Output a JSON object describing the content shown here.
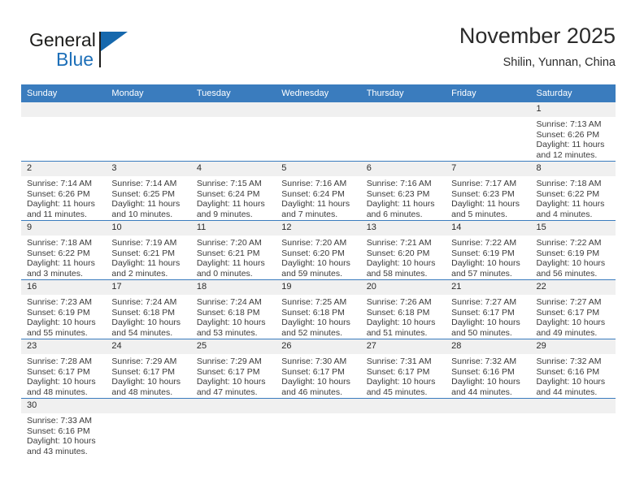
{
  "brand": {
    "name_part1": "General",
    "name_part2": "Blue"
  },
  "header": {
    "title": "November 2025",
    "subtitle": "Shilin, Yunnan, China"
  },
  "colors": {
    "header_blue": "#3a7cbe",
    "brand_blue": "#1d6fb8",
    "date_band": "#f0f0f0"
  },
  "weekday_headers": [
    "Sunday",
    "Monday",
    "Tuesday",
    "Wednesday",
    "Thursday",
    "Friday",
    "Saturday"
  ],
  "weeks": [
    [
      {
        "day": "",
        "sunrise": "",
        "sunset": "",
        "daylight1": "",
        "daylight2": "",
        "blank": true
      },
      {
        "day": "",
        "sunrise": "",
        "sunset": "",
        "daylight1": "",
        "daylight2": "",
        "blank": true
      },
      {
        "day": "",
        "sunrise": "",
        "sunset": "",
        "daylight1": "",
        "daylight2": "",
        "blank": true
      },
      {
        "day": "",
        "sunrise": "",
        "sunset": "",
        "daylight1": "",
        "daylight2": "",
        "blank": true
      },
      {
        "day": "",
        "sunrise": "",
        "sunset": "",
        "daylight1": "",
        "daylight2": "",
        "blank": true
      },
      {
        "day": "",
        "sunrise": "",
        "sunset": "",
        "daylight1": "",
        "daylight2": "",
        "blank": true
      },
      {
        "day": "1",
        "sunrise": "Sunrise: 7:13 AM",
        "sunset": "Sunset: 6:26 PM",
        "daylight1": "Daylight: 11 hours",
        "daylight2": "and 12 minutes."
      }
    ],
    [
      {
        "day": "2",
        "sunrise": "Sunrise: 7:14 AM",
        "sunset": "Sunset: 6:26 PM",
        "daylight1": "Daylight: 11 hours",
        "daylight2": "and 11 minutes."
      },
      {
        "day": "3",
        "sunrise": "Sunrise: 7:14 AM",
        "sunset": "Sunset: 6:25 PM",
        "daylight1": "Daylight: 11 hours",
        "daylight2": "and 10 minutes."
      },
      {
        "day": "4",
        "sunrise": "Sunrise: 7:15 AM",
        "sunset": "Sunset: 6:24 PM",
        "daylight1": "Daylight: 11 hours",
        "daylight2": "and 9 minutes."
      },
      {
        "day": "5",
        "sunrise": "Sunrise: 7:16 AM",
        "sunset": "Sunset: 6:24 PM",
        "daylight1": "Daylight: 11 hours",
        "daylight2": "and 7 minutes."
      },
      {
        "day": "6",
        "sunrise": "Sunrise: 7:16 AM",
        "sunset": "Sunset: 6:23 PM",
        "daylight1": "Daylight: 11 hours",
        "daylight2": "and 6 minutes."
      },
      {
        "day": "7",
        "sunrise": "Sunrise: 7:17 AM",
        "sunset": "Sunset: 6:23 PM",
        "daylight1": "Daylight: 11 hours",
        "daylight2": "and 5 minutes."
      },
      {
        "day": "8",
        "sunrise": "Sunrise: 7:18 AM",
        "sunset": "Sunset: 6:22 PM",
        "daylight1": "Daylight: 11 hours",
        "daylight2": "and 4 minutes."
      }
    ],
    [
      {
        "day": "9",
        "sunrise": "Sunrise: 7:18 AM",
        "sunset": "Sunset: 6:22 PM",
        "daylight1": "Daylight: 11 hours",
        "daylight2": "and 3 minutes."
      },
      {
        "day": "10",
        "sunrise": "Sunrise: 7:19 AM",
        "sunset": "Sunset: 6:21 PM",
        "daylight1": "Daylight: 11 hours",
        "daylight2": "and 2 minutes."
      },
      {
        "day": "11",
        "sunrise": "Sunrise: 7:20 AM",
        "sunset": "Sunset: 6:21 PM",
        "daylight1": "Daylight: 11 hours",
        "daylight2": "and 0 minutes."
      },
      {
        "day": "12",
        "sunrise": "Sunrise: 7:20 AM",
        "sunset": "Sunset: 6:20 PM",
        "daylight1": "Daylight: 10 hours",
        "daylight2": "and 59 minutes."
      },
      {
        "day": "13",
        "sunrise": "Sunrise: 7:21 AM",
        "sunset": "Sunset: 6:20 PM",
        "daylight1": "Daylight: 10 hours",
        "daylight2": "and 58 minutes."
      },
      {
        "day": "14",
        "sunrise": "Sunrise: 7:22 AM",
        "sunset": "Sunset: 6:19 PM",
        "daylight1": "Daylight: 10 hours",
        "daylight2": "and 57 minutes."
      },
      {
        "day": "15",
        "sunrise": "Sunrise: 7:22 AM",
        "sunset": "Sunset: 6:19 PM",
        "daylight1": "Daylight: 10 hours",
        "daylight2": "and 56 minutes."
      }
    ],
    [
      {
        "day": "16",
        "sunrise": "Sunrise: 7:23 AM",
        "sunset": "Sunset: 6:19 PM",
        "daylight1": "Daylight: 10 hours",
        "daylight2": "and 55 minutes."
      },
      {
        "day": "17",
        "sunrise": "Sunrise: 7:24 AM",
        "sunset": "Sunset: 6:18 PM",
        "daylight1": "Daylight: 10 hours",
        "daylight2": "and 54 minutes."
      },
      {
        "day": "18",
        "sunrise": "Sunrise: 7:24 AM",
        "sunset": "Sunset: 6:18 PM",
        "daylight1": "Daylight: 10 hours",
        "daylight2": "and 53 minutes."
      },
      {
        "day": "19",
        "sunrise": "Sunrise: 7:25 AM",
        "sunset": "Sunset: 6:18 PM",
        "daylight1": "Daylight: 10 hours",
        "daylight2": "and 52 minutes."
      },
      {
        "day": "20",
        "sunrise": "Sunrise: 7:26 AM",
        "sunset": "Sunset: 6:18 PM",
        "daylight1": "Daylight: 10 hours",
        "daylight2": "and 51 minutes."
      },
      {
        "day": "21",
        "sunrise": "Sunrise: 7:27 AM",
        "sunset": "Sunset: 6:17 PM",
        "daylight1": "Daylight: 10 hours",
        "daylight2": "and 50 minutes."
      },
      {
        "day": "22",
        "sunrise": "Sunrise: 7:27 AM",
        "sunset": "Sunset: 6:17 PM",
        "daylight1": "Daylight: 10 hours",
        "daylight2": "and 49 minutes."
      }
    ],
    [
      {
        "day": "23",
        "sunrise": "Sunrise: 7:28 AM",
        "sunset": "Sunset: 6:17 PM",
        "daylight1": "Daylight: 10 hours",
        "daylight2": "and 48 minutes."
      },
      {
        "day": "24",
        "sunrise": "Sunrise: 7:29 AM",
        "sunset": "Sunset: 6:17 PM",
        "daylight1": "Daylight: 10 hours",
        "daylight2": "and 48 minutes."
      },
      {
        "day": "25",
        "sunrise": "Sunrise: 7:29 AM",
        "sunset": "Sunset: 6:17 PM",
        "daylight1": "Daylight: 10 hours",
        "daylight2": "and 47 minutes."
      },
      {
        "day": "26",
        "sunrise": "Sunrise: 7:30 AM",
        "sunset": "Sunset: 6:17 PM",
        "daylight1": "Daylight: 10 hours",
        "daylight2": "and 46 minutes."
      },
      {
        "day": "27",
        "sunrise": "Sunrise: 7:31 AM",
        "sunset": "Sunset: 6:17 PM",
        "daylight1": "Daylight: 10 hours",
        "daylight2": "and 45 minutes."
      },
      {
        "day": "28",
        "sunrise": "Sunrise: 7:32 AM",
        "sunset": "Sunset: 6:16 PM",
        "daylight1": "Daylight: 10 hours",
        "daylight2": "and 44 minutes."
      },
      {
        "day": "29",
        "sunrise": "Sunrise: 7:32 AM",
        "sunset": "Sunset: 6:16 PM",
        "daylight1": "Daylight: 10 hours",
        "daylight2": "and 44 minutes."
      }
    ],
    [
      {
        "day": "30",
        "sunrise": "Sunrise: 7:33 AM",
        "sunset": "Sunset: 6:16 PM",
        "daylight1": "Daylight: 10 hours",
        "daylight2": "and 43 minutes."
      },
      {
        "day": "",
        "sunrise": "",
        "sunset": "",
        "daylight1": "",
        "daylight2": "",
        "blank": true
      },
      {
        "day": "",
        "sunrise": "",
        "sunset": "",
        "daylight1": "",
        "daylight2": "",
        "blank": true
      },
      {
        "day": "",
        "sunrise": "",
        "sunset": "",
        "daylight1": "",
        "daylight2": "",
        "blank": true
      },
      {
        "day": "",
        "sunrise": "",
        "sunset": "",
        "daylight1": "",
        "daylight2": "",
        "blank": true
      },
      {
        "day": "",
        "sunrise": "",
        "sunset": "",
        "daylight1": "",
        "daylight2": "",
        "blank": true
      },
      {
        "day": "",
        "sunrise": "",
        "sunset": "",
        "daylight1": "",
        "daylight2": "",
        "blank": true
      }
    ]
  ]
}
